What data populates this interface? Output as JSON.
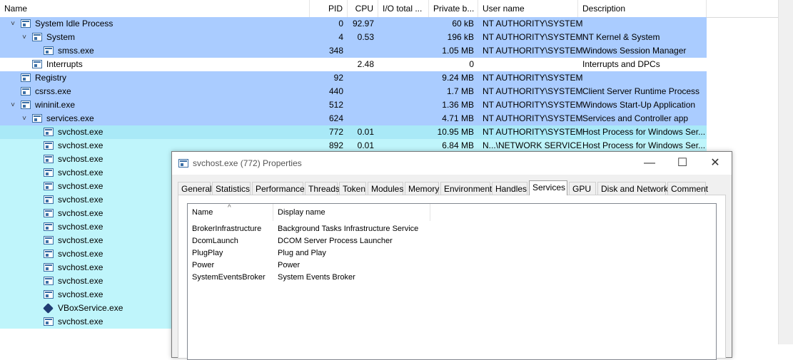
{
  "columns": {
    "name": "Name",
    "pid": "PID",
    "cpu": "CPU",
    "io": "I/O total ...",
    "private": "Private b...",
    "user": "User name",
    "desc": "Description"
  },
  "colors": {
    "service_row": "#aaccff",
    "own_process_row": "#bff5fb",
    "interrupt_row": "#ffffff"
  },
  "processes": [
    {
      "name": "System Idle Process",
      "pid": "0",
      "cpu": "92.97",
      "io": "",
      "private": "60 kB",
      "user": "NT AUTHORITY\\SYSTEM",
      "desc": "",
      "level": 0,
      "expanded": true,
      "icon": "process-window-icon"
    },
    {
      "name": "System",
      "pid": "4",
      "cpu": "0.53",
      "io": "",
      "private": "196 kB",
      "user": "NT AUTHORITY\\SYSTEM",
      "desc": "NT Kernel & System",
      "level": 1,
      "expanded": true,
      "icon": "process-window-icon"
    },
    {
      "name": "smss.exe",
      "pid": "348",
      "cpu": "",
      "io": "",
      "private": "1.05 MB",
      "user": "NT AUTHORITY\\SYSTEM",
      "desc": "Windows Session Manager",
      "level": 2,
      "icon": "process-window-icon"
    },
    {
      "name": "Interrupts",
      "pid": "",
      "cpu": "2.48",
      "io": "",
      "private": "0",
      "user": "",
      "desc": "Interrupts and DPCs",
      "level": 1,
      "icon": "process-window-icon"
    },
    {
      "name": "Registry",
      "pid": "92",
      "cpu": "",
      "io": "",
      "private": "9.24 MB",
      "user": "NT AUTHORITY\\SYSTEM",
      "desc": "",
      "level": 0,
      "icon": "process-window-icon"
    },
    {
      "name": "csrss.exe",
      "pid": "440",
      "cpu": "",
      "io": "",
      "private": "1.7 MB",
      "user": "NT AUTHORITY\\SYSTEM",
      "desc": "Client Server Runtime Process",
      "level": 0,
      "icon": "process-window-icon"
    },
    {
      "name": "wininit.exe",
      "pid": "512",
      "cpu": "",
      "io": "",
      "private": "1.36 MB",
      "user": "NT AUTHORITY\\SYSTEM",
      "desc": "Windows Start-Up Application",
      "level": 0,
      "expanded": true,
      "icon": "process-window-icon"
    },
    {
      "name": "services.exe",
      "pid": "624",
      "cpu": "",
      "io": "",
      "private": "4.71 MB",
      "user": "NT AUTHORITY\\SYSTEM",
      "desc": "Services and Controller app",
      "level": 1,
      "expanded": true,
      "icon": "process-window-icon"
    },
    {
      "name": "svchost.exe",
      "pid": "772",
      "cpu": "0.01",
      "io": "",
      "private": "10.95 MB",
      "user": "NT AUTHORITY\\SYSTEM",
      "desc": "Host Process for Windows Ser...",
      "level": 2,
      "icon": "process-window-icon",
      "selected": true
    },
    {
      "name": "svchost.exe",
      "pid": "892",
      "cpu": "0.01",
      "io": "",
      "private": "6.84 MB",
      "user": "N...\\NETWORK SERVICE",
      "desc": "Host Process for Windows Ser...",
      "level": 2,
      "icon": "process-window-icon"
    },
    {
      "name": "svchost.exe",
      "level": 2,
      "icon": "process-window-icon"
    },
    {
      "name": "svchost.exe",
      "level": 2,
      "icon": "process-window-icon"
    },
    {
      "name": "svchost.exe",
      "level": 2,
      "icon": "process-window-icon"
    },
    {
      "name": "svchost.exe",
      "level": 2,
      "icon": "process-window-icon"
    },
    {
      "name": "svchost.exe",
      "level": 2,
      "icon": "process-window-icon"
    },
    {
      "name": "svchost.exe",
      "level": 2,
      "icon": "process-window-icon"
    },
    {
      "name": "svchost.exe",
      "level": 2,
      "icon": "process-window-icon"
    },
    {
      "name": "svchost.exe",
      "level": 2,
      "icon": "process-window-icon"
    },
    {
      "name": "svchost.exe",
      "level": 2,
      "icon": "process-window-icon"
    },
    {
      "name": "svchost.exe",
      "level": 2,
      "icon": "process-window-icon"
    },
    {
      "name": "svchost.exe",
      "level": 2,
      "icon": "process-window-icon"
    },
    {
      "name": "VBoxService.exe",
      "level": 2,
      "icon": "virtualbox-icon"
    },
    {
      "name": "svchost.exe",
      "level": 2,
      "icon": "process-window-icon"
    }
  ],
  "dialog": {
    "title": "svchost.exe (772) Properties",
    "controls": {
      "minimize": "—",
      "maximize": "☐",
      "close": "✕"
    },
    "tabs": [
      "General",
      "Statistics",
      "Performance",
      "Threads",
      "Token",
      "Modules",
      "Memory",
      "Environment",
      "Handles",
      "Services",
      "GPU",
      "Disk and Network",
      "Comment"
    ],
    "active_tab": "Services",
    "services_list": {
      "col_name": "Name",
      "col_display": "Display name",
      "sort_glyph": "^",
      "rows": [
        {
          "name": "BrokerInfrastructure",
          "display": "Background Tasks Infrastructure Service"
        },
        {
          "name": "DcomLaunch",
          "display": "DCOM Server Process Launcher"
        },
        {
          "name": "PlugPlay",
          "display": "Plug and Play"
        },
        {
          "name": "Power",
          "display": "Power"
        },
        {
          "name": "SystemEventsBroker",
          "display": "System Events Broker"
        }
      ]
    }
  }
}
